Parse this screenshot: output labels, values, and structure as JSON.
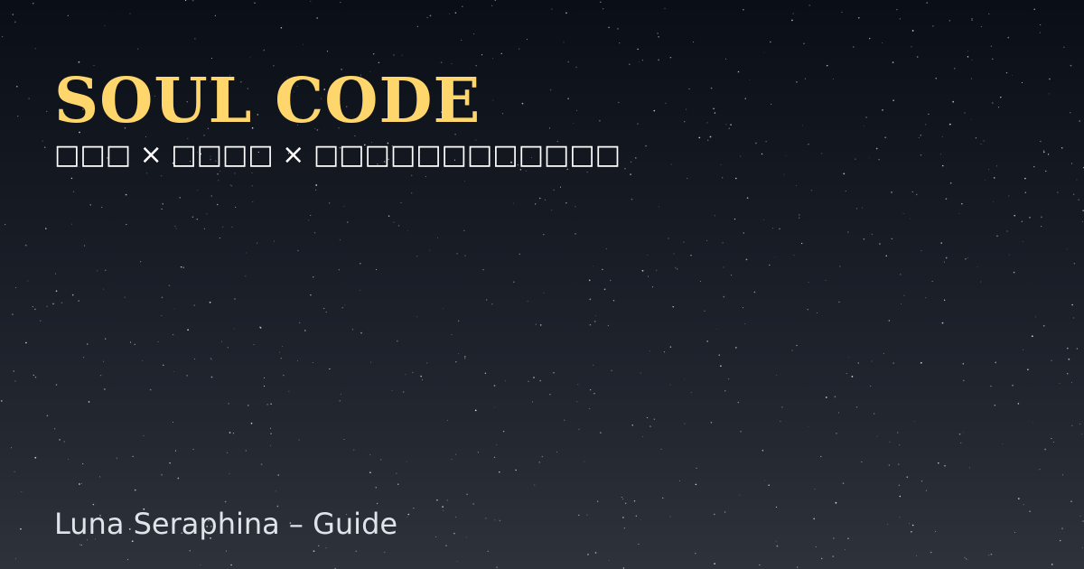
{
  "title": "SOUL CODE",
  "subtitle": "□□□ × □□□□ × □□□□□□□□□□□□",
  "footer": "Luna Seraphina – Guide",
  "colors": {
    "title": "#ffd66b",
    "subtitle": "#ffffff",
    "footer": "#dfe3ea",
    "star": "#ffffff",
    "background_top": "#0a0e16",
    "background_bottom": "#2e323a"
  }
}
